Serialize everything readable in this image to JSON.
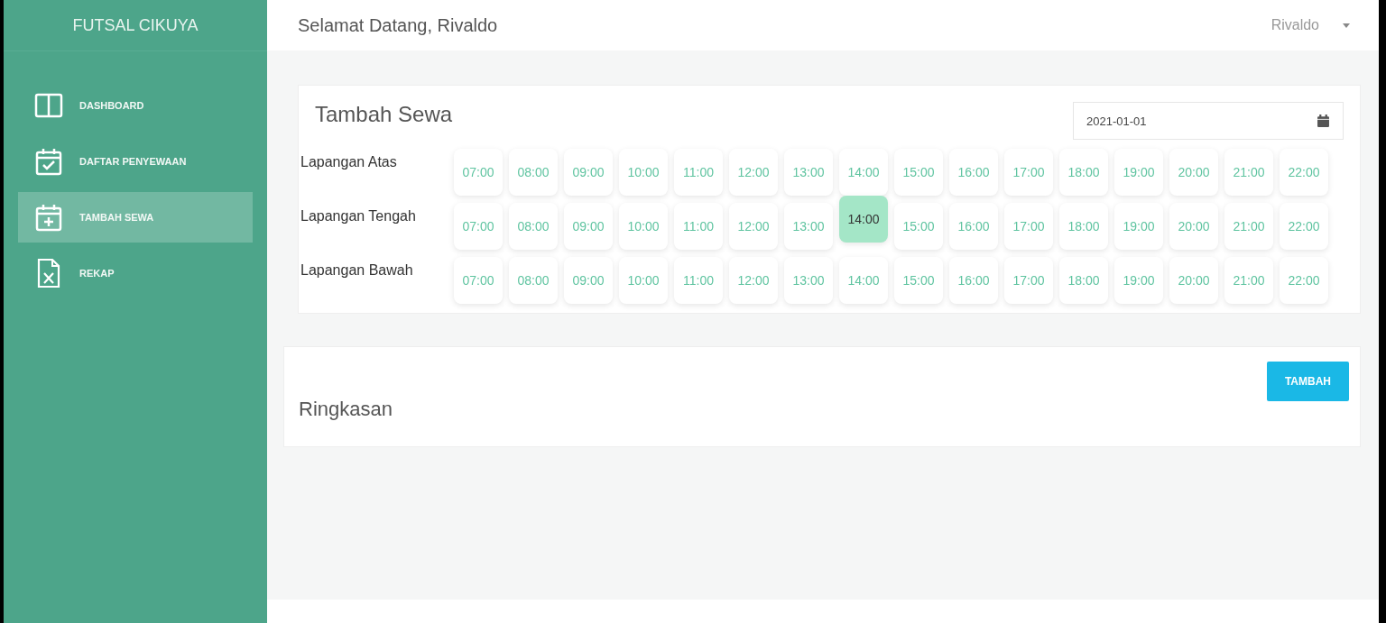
{
  "sidebar": {
    "brand": "FUTSAL CIKUYA",
    "items": [
      {
        "label": "DASHBOARD",
        "selected": false
      },
      {
        "label": "DAFTAR PENYEWAAN",
        "selected": false
      },
      {
        "label": "TAMBAH SEWA",
        "selected": true
      },
      {
        "label": "REKAP",
        "selected": false
      }
    ]
  },
  "topbar": {
    "greeting": "Selamat Datang, Rivaldo",
    "user": "Rivaldo"
  },
  "booking": {
    "title": "Tambah Sewa",
    "date": "2021-01-01",
    "courts": [
      {
        "name": "Lapangan Atas",
        "slots": [
          {
            "time": "07:00",
            "selected": false
          },
          {
            "time": "08:00",
            "selected": false
          },
          {
            "time": "09:00",
            "selected": false
          },
          {
            "time": "10:00",
            "selected": false
          },
          {
            "time": "11:00",
            "selected": false
          },
          {
            "time": "12:00",
            "selected": false
          },
          {
            "time": "13:00",
            "selected": false
          },
          {
            "time": "14:00",
            "selected": false
          },
          {
            "time": "15:00",
            "selected": false
          },
          {
            "time": "16:00",
            "selected": false
          },
          {
            "time": "17:00",
            "selected": false
          },
          {
            "time": "18:00",
            "selected": false
          },
          {
            "time": "19:00",
            "selected": false
          },
          {
            "time": "20:00",
            "selected": false
          },
          {
            "time": "21:00",
            "selected": false
          },
          {
            "time": "22:00",
            "selected": false
          }
        ]
      },
      {
        "name": "Lapangan Tengah",
        "slots": [
          {
            "time": "07:00",
            "selected": false
          },
          {
            "time": "08:00",
            "selected": false
          },
          {
            "time": "09:00",
            "selected": false
          },
          {
            "time": "10:00",
            "selected": false
          },
          {
            "time": "11:00",
            "selected": false
          },
          {
            "time": "12:00",
            "selected": false
          },
          {
            "time": "13:00",
            "selected": false
          },
          {
            "time": "14:00",
            "selected": true
          },
          {
            "time": "15:00",
            "selected": false
          },
          {
            "time": "16:00",
            "selected": false
          },
          {
            "time": "17:00",
            "selected": false
          },
          {
            "time": "18:00",
            "selected": false
          },
          {
            "time": "19:00",
            "selected": false
          },
          {
            "time": "20:00",
            "selected": false
          },
          {
            "time": "21:00",
            "selected": false
          },
          {
            "time": "22:00",
            "selected": false
          }
        ]
      },
      {
        "name": "Lapangan Bawah",
        "slots": [
          {
            "time": "07:00",
            "selected": false
          },
          {
            "time": "08:00",
            "selected": false
          },
          {
            "time": "09:00",
            "selected": false
          },
          {
            "time": "10:00",
            "selected": false
          },
          {
            "time": "11:00",
            "selected": false
          },
          {
            "time": "12:00",
            "selected": false
          },
          {
            "time": "13:00",
            "selected": false
          },
          {
            "time": "14:00",
            "selected": false
          },
          {
            "time": "15:00",
            "selected": false
          },
          {
            "time": "16:00",
            "selected": false
          },
          {
            "time": "17:00",
            "selected": false
          },
          {
            "time": "18:00",
            "selected": false
          },
          {
            "time": "19:00",
            "selected": false
          },
          {
            "time": "20:00",
            "selected": false
          },
          {
            "time": "21:00",
            "selected": false
          },
          {
            "time": "22:00",
            "selected": false
          }
        ]
      }
    ]
  },
  "summary": {
    "title": "Ringkasan",
    "button": "TAMBAH"
  }
}
